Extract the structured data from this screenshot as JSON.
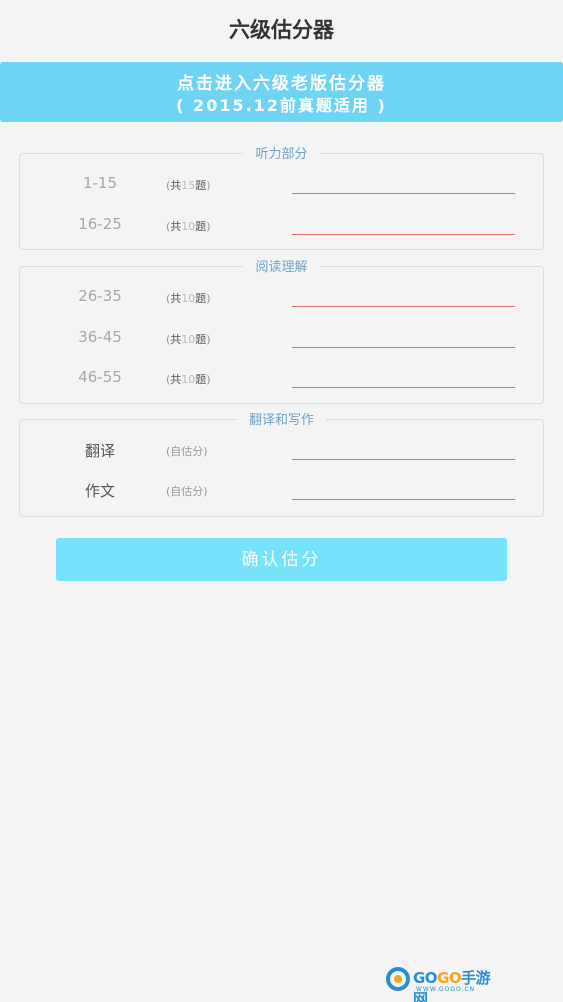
{
  "header": {
    "title": "六级估分器"
  },
  "banner": {
    "line1": "点击进入六级老版估分器",
    "line2": "( 2015.12前真题适用 )"
  },
  "sections": [
    {
      "legend": "听力部分",
      "rows": [
        {
          "range": "1-15",
          "count_open": "(",
          "count_prefix": "共",
          "count_num": "15",
          "count_suffix": "题",
          "count_close": ")",
          "value": ""
        },
        {
          "range": "16-25",
          "count_open": "(",
          "count_prefix": "共",
          "count_num": "10",
          "count_suffix": "题",
          "count_close": ")",
          "value": ""
        }
      ]
    },
    {
      "legend": "阅读理解",
      "rows": [
        {
          "range": "26-35",
          "count_open": "(",
          "count_prefix": "共",
          "count_num": "10",
          "count_suffix": "题",
          "count_close": ")",
          "value": ""
        },
        {
          "range": "36-45",
          "count_open": "(",
          "count_prefix": "共",
          "count_num": "10",
          "count_suffix": "题",
          "count_close": ")",
          "value": ""
        },
        {
          "range": "46-55",
          "count_open": "(",
          "count_prefix": "共",
          "count_num": "10",
          "count_suffix": "题",
          "count_close": ")",
          "value": ""
        }
      ]
    },
    {
      "legend": "翻译和写作",
      "rows": [
        {
          "range": "翻译",
          "count_text": "(自估分)",
          "value": ""
        },
        {
          "range": "作文",
          "count_text": "(自估分)",
          "value": ""
        }
      ]
    }
  ],
  "confirm_button": {
    "label": "确认估分"
  },
  "logo": {
    "brand_a": "GO",
    "brand_b": "GO",
    "brand_c": "手游网",
    "url": "WWW.GOGO.CN"
  },
  "colors": {
    "banner": "#6fd4f4",
    "confirm": "#76e2fc",
    "legend": "#6fa3c8",
    "input_underline": "#e07070",
    "brand_blue": "#2a8fd0",
    "brand_orange": "#f5a623"
  }
}
